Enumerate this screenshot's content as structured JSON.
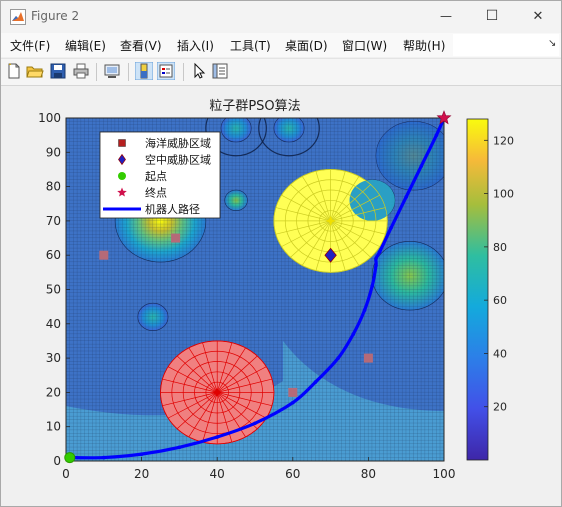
{
  "window": {
    "title": "Figure 2",
    "minimize_glyph": "—",
    "maximize_glyph": "☐",
    "close_glyph": "✕",
    "app_icon": "matlab-icon"
  },
  "menu": {
    "items": [
      "文件(F)",
      "编辑(E)",
      "查看(V)",
      "插入(I)",
      "工具(T)",
      "桌面(D)",
      "窗口(W)",
      "帮助(H)"
    ],
    "overflow_glyph": "↘"
  },
  "toolbar": {
    "buttons": [
      "new-figure-icon",
      "open-icon",
      "save-icon",
      "print-icon",
      "link-plot-icon",
      "colorbar-icon",
      "legend-icon",
      "pointer-icon",
      "property-editor-icon"
    ]
  },
  "chart_data": {
    "type": "scatter",
    "title": "粒子群PSO算法",
    "xlabel": "",
    "ylabel": "",
    "xlim": [
      0,
      100
    ],
    "ylim": [
      0,
      100
    ],
    "xticks": [
      0,
      20,
      40,
      60,
      80,
      100
    ],
    "yticks": [
      0,
      10,
      20,
      30,
      40,
      50,
      60,
      70,
      80,
      90,
      100
    ],
    "grid": "mesh on",
    "background_surface_colormap": "parula",
    "colorbar": {
      "ticks": [
        20,
        40,
        60,
        80,
        100,
        120
      ],
      "range": [
        0,
        128
      ]
    },
    "legend": {
      "location": "top-left",
      "entries": [
        {
          "label": "海洋威胁区域",
          "marker": "square",
          "color": "#b51f1f"
        },
        {
          "label": "空中威胁区域",
          "marker": "diamond",
          "color": "#2020c0"
        },
        {
          "label": "起点",
          "marker": "circle",
          "color": "#33cc00"
        },
        {
          "label": "终点",
          "marker": "star",
          "color": "#d0104c"
        },
        {
          "label": "机器人路径",
          "marker": "line",
          "color": "#0000ff"
        }
      ]
    },
    "ocean_threat_regions": [
      {
        "x": 10,
        "y": 60
      },
      {
        "x": 29,
        "y": 65
      },
      {
        "x": 60,
        "y": 20
      },
      {
        "x": 80,
        "y": 30
      }
    ],
    "air_threat_regions": [
      {
        "x": 70,
        "y": 60,
        "radius": 15,
        "color": "#ffff55",
        "line_color": "#cccc22"
      },
      {
        "x": 40,
        "y": 20,
        "radius": 15,
        "color": "#f08080",
        "line_color": "#e00000"
      }
    ],
    "start_point": {
      "x": 1,
      "y": 1
    },
    "end_point": {
      "x": 100,
      "y": 100
    },
    "robot_path": {
      "x": [
        1,
        10,
        20,
        30,
        40,
        50,
        60,
        66,
        72,
        76,
        79,
        81,
        82,
        82,
        83,
        86,
        90,
        94,
        98,
        100
      ],
      "y": [
        1,
        1,
        2,
        4,
        7,
        11,
        17,
        23,
        30,
        37,
        44,
        51,
        57,
        59,
        61,
        68,
        77,
        86,
        95,
        100
      ]
    },
    "terrain_bumps": [
      {
        "x": 92,
        "y": 89,
        "radius": 10,
        "peak": 62
      },
      {
        "x": 91,
        "y": 54,
        "radius": 10,
        "peak": 72
      },
      {
        "x": 81,
        "y": 76,
        "radius": 6,
        "peak": 55
      },
      {
        "x": 25,
        "y": 70,
        "radius": 12,
        "peak": 105
      },
      {
        "x": 59,
        "y": 97,
        "radius": 4,
        "peak": 40
      },
      {
        "x": 59,
        "y": 97,
        "radius": 8,
        "peak": 0
      },
      {
        "x": 45,
        "y": 97,
        "radius": 4,
        "peak": 55
      },
      {
        "x": 45,
        "y": 97,
        "radius": 8,
        "peak": 0
      },
      {
        "x": 45,
        "y": 76,
        "radius": 3,
        "peak": 65
      },
      {
        "x": 23,
        "y": 42,
        "radius": 4,
        "peak": 30
      }
    ]
  }
}
